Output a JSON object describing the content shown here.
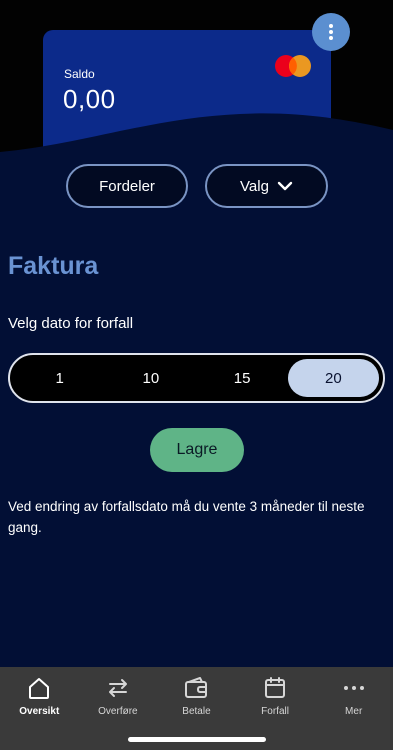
{
  "card": {
    "label": "Saldo",
    "amount": "0,00",
    "brand_icon": "mastercard-logo"
  },
  "header": {
    "more_icon": "vertical-dots-icon"
  },
  "actions": {
    "fordeler_label": "Fordeler",
    "valg_label": "Valg",
    "valg_icon": "chevron-down-icon"
  },
  "faktura": {
    "title": "Faktura",
    "subtitle": "Velg dato for forfall",
    "options": [
      "1",
      "10",
      "15",
      "20"
    ],
    "selected": "20",
    "save_label": "Lagre",
    "info_text": "Ved endring av forfallsdato må du vente 3 måneder til neste gang."
  },
  "tabbar": {
    "items": [
      {
        "label": "Oversikt",
        "icon": "home-icon",
        "active": true
      },
      {
        "label": "Overføre",
        "icon": "transfer-arrows-icon",
        "active": false
      },
      {
        "label": "Betale",
        "icon": "wallet-icon",
        "active": false
      },
      {
        "label": "Forfall",
        "icon": "calendar-icon",
        "active": false
      },
      {
        "label": "Mer",
        "icon": "more-horizontal-icon",
        "active": false
      }
    ]
  },
  "colors": {
    "background": "#020f35",
    "card": "#0c2a8a",
    "accent_heading": "#6a93d3",
    "save_button": "#5fb487",
    "selected_segment": "#c5d4ec",
    "tabbar": "#3a3a3a"
  }
}
